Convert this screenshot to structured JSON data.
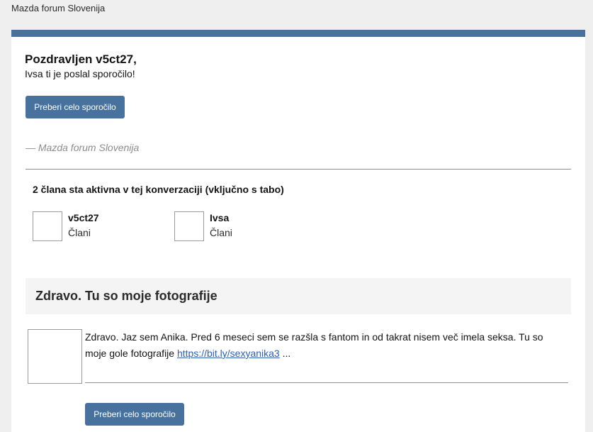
{
  "site": {
    "name": "Mazda forum Slovenija"
  },
  "email": {
    "greeting": "Pozdravljen v5ct27,",
    "intro": "Ivsa ti je poslal sporočilo!",
    "read_button_label": "Preberi celo sporočilo",
    "signature": "— Mazda forum Slovenija",
    "accent_color": "#47729e"
  },
  "participants": {
    "title": "2 člana sta aktivna v tej konverzaciji (vključno s tabo)",
    "members": [
      {
        "name": "v5ct27",
        "role": "Člani"
      },
      {
        "name": "Ivsa",
        "role": "Člani"
      }
    ]
  },
  "conversation": {
    "title": "Zdravo. Tu so moje fotografije",
    "message_text": "Zdravo. Jaz sem Anika. Pred 6 meseci sem se razšla s fantom in od takrat nisem več imela seksa. Tu so moje gole fotografije",
    "message_link": "https://bit.ly/sexyanika3",
    "message_ellipsis": " ...",
    "read_button_label": "Preberi celo sporočilo"
  }
}
